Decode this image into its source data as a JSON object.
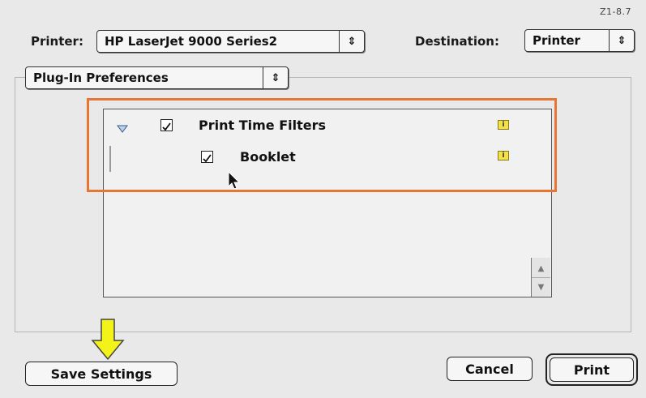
{
  "figure_id": "Z1-8.7",
  "printer": {
    "label": "Printer:",
    "value": "HP LaserJet 9000 Series2"
  },
  "destination": {
    "label": "Destination:",
    "value": "Printer"
  },
  "panel": {
    "value": "Plug-In Preferences"
  },
  "list": {
    "items": [
      {
        "label": "Print Time Filters",
        "checked": true,
        "expanded": true,
        "icon": "info-icon"
      },
      {
        "label": "Booklet",
        "checked": true,
        "icon": "info-icon"
      }
    ]
  },
  "buttons": {
    "save_settings": "Save Settings",
    "cancel": "Cancel",
    "print": "Print"
  },
  "colors": {
    "highlight": "#e87532",
    "pointer_arrow": "#f3f31a",
    "info_icon": "#f2e14a"
  }
}
